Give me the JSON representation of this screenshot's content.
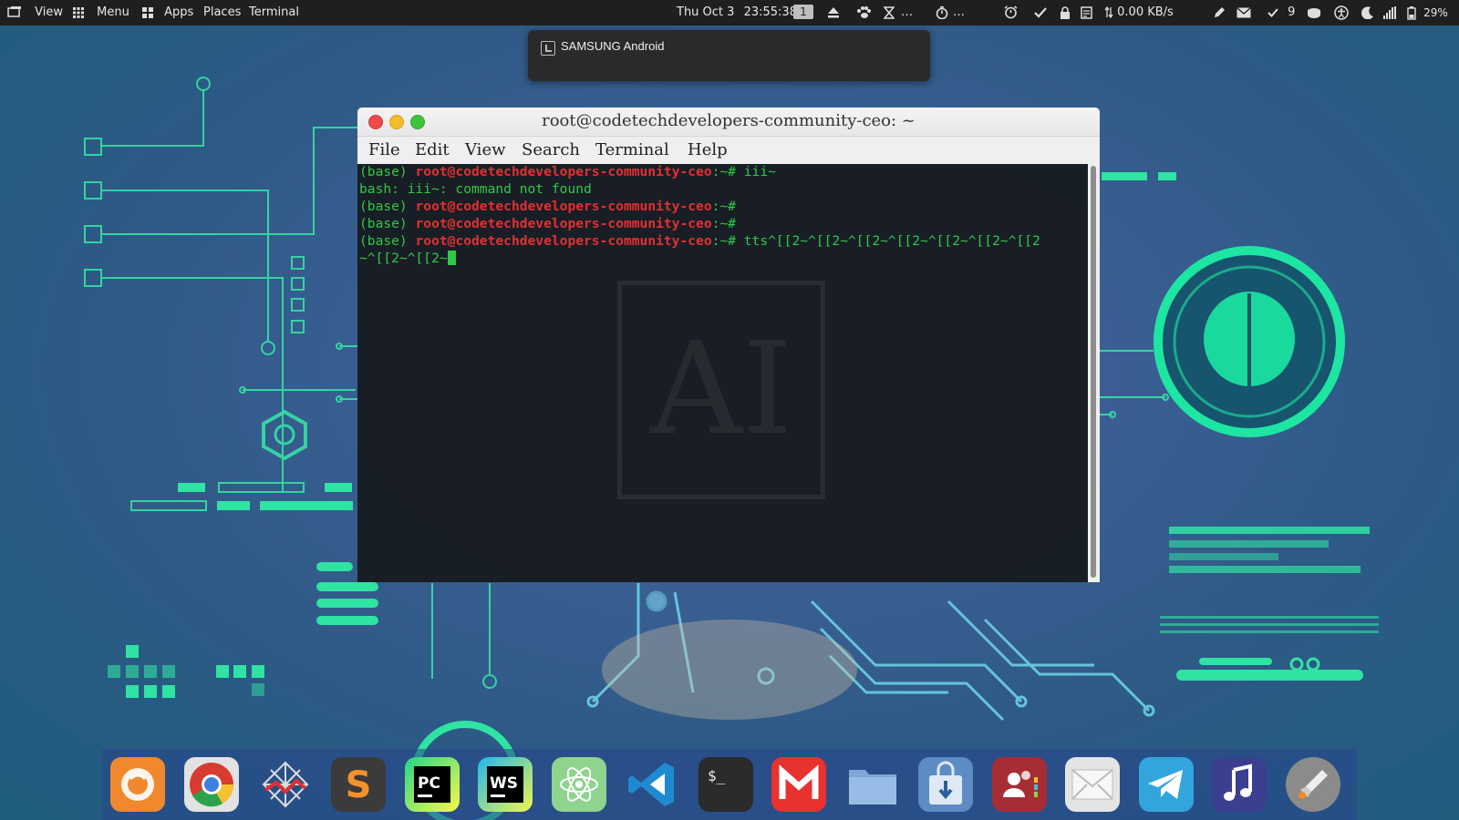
{
  "topbar": {
    "view_label": "View",
    "menu_label": "Menu",
    "apps_label": "Apps",
    "places_label": "Places",
    "terminal_label": "Terminal",
    "date": "Thu Oct 3",
    "time": "23:55:38",
    "workspace": "1",
    "ellipsis1": "…",
    "ellipsis2": "…",
    "net_speed": "0.00 KB/s",
    "updates_count": "9",
    "battery": "29%"
  },
  "notification": {
    "title": "SAMSUNG Android"
  },
  "terminal": {
    "title": "root@codetechdevelopers-community-ceo: ~",
    "menu": [
      "File",
      "Edit",
      "View",
      "Search",
      "Terminal",
      "Help"
    ],
    "lines": [
      {
        "prefix": "(base) ",
        "host": "root@codetechdevelopers-community-ceo",
        "suffix": ":~# iii~"
      },
      {
        "text": "bash: iii~: command not found"
      },
      {
        "prefix": "(base) ",
        "host": "root@codetechdevelopers-community-ceo",
        "suffix": ":~#"
      },
      {
        "prefix": "(base) ",
        "host": "root@codetechdevelopers-community-ceo",
        "suffix": ":~#"
      },
      {
        "prefix": "(base) ",
        "host": "root@codetechdevelopers-community-ceo",
        "suffix": ":~# tts^[[2~^[[2~^[[2~^[[2~^[[2~^[[2~^[[2"
      },
      {
        "text": "~^[[2~^[[2~"
      }
    ],
    "wallpaper_text": "AI"
  },
  "dock": {
    "apps": [
      "firefox-icon",
      "chrome-icon",
      "wireshark-icon",
      "sublime-icon",
      "pycharm-icon",
      "webstorm-icon",
      "atom-icon",
      "vscode-icon",
      "terminal-icon",
      "gmail-icon",
      "files-icon",
      "installer-icon",
      "contacts-icon",
      "mail-icon",
      "telegram-icon",
      "music-icon",
      "launchpad-icon"
    ],
    "pycharm_label": "PC",
    "webstorm_label": "WS",
    "sublime_label": "S",
    "terminal_label": "$_"
  },
  "colors": {
    "accent_green": "#19e6a0",
    "term_green": "#2fc944",
    "term_red": "#e23030"
  }
}
